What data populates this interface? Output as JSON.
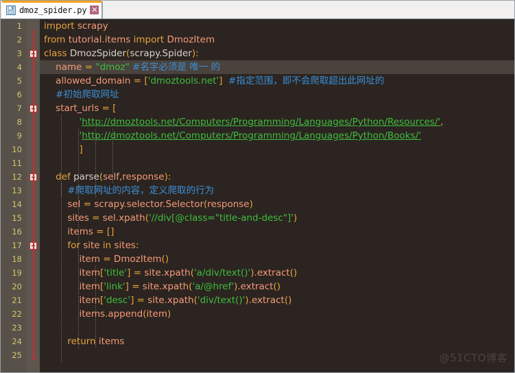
{
  "window": {
    "border_color": "#9aa0a6",
    "background": "#2b2420"
  },
  "tabbar": {
    "background": "#f1f0ef",
    "active_accent_color": "#f5a21e",
    "tabs": [
      {
        "label": "dmoz_spider.py",
        "icon": "save-floppy-icon",
        "close_label": "✕",
        "active": true
      }
    ]
  },
  "editor": {
    "theme": {
      "background": "#2b2420",
      "gutter_background": "#57514a",
      "line_number_color": "#cfc76a",
      "current_line_background": "#4a423c",
      "fold_line_color": "#d02a2a",
      "keyword_color": "#e8a33d",
      "string_color": "#3fbf3f",
      "comment_color": "#3b8fd6",
      "identifier_color": "#f79b7a",
      "text_color": "#d8d2cc"
    },
    "current_line": 4,
    "first_line_number": 1,
    "line_numbers": [
      1,
      2,
      3,
      4,
      5,
      6,
      7,
      8,
      9,
      10,
      11,
      12,
      13,
      14,
      15,
      16,
      17,
      18,
      19,
      20,
      21,
      22,
      23,
      24,
      25
    ],
    "fold_markers": [
      3,
      7,
      12,
      17
    ],
    "lines": [
      {
        "n": 1,
        "text": "import scrapy"
      },
      {
        "n": 2,
        "text": "from tutorial.items import DmozItem"
      },
      {
        "n": 3,
        "text": "class DmozSpider(scrapy.Spider):"
      },
      {
        "n": 4,
        "text": "    name = \"dmoz\" #名字必须是 唯一 的"
      },
      {
        "n": 5,
        "text": "    allowed_domain = ['dmoztools.net']  #指定范围，即不会爬取超出此网址的"
      },
      {
        "n": 6,
        "text": "    #初始爬取网址"
      },
      {
        "n": 7,
        "text": "    start_urls = ["
      },
      {
        "n": 8,
        "text": "            'http://dmoztools.net/Computers/Programming/Languages/Python/Resources/',"
      },
      {
        "n": 9,
        "text": "            'http://dmoztools.net/Computers/Programming/Languages/Python/Books/'"
      },
      {
        "n": 10,
        "text": "            ]"
      },
      {
        "n": 11,
        "text": ""
      },
      {
        "n": 12,
        "text": "    def parse(self,response):"
      },
      {
        "n": 13,
        "text": "        #爬取网址的内容，定义爬取的行为"
      },
      {
        "n": 14,
        "text": "        sel = scrapy.selector.Selector(response)"
      },
      {
        "n": 15,
        "text": "        sites = sel.xpath('//div[@class=\"title-and-desc\"]')"
      },
      {
        "n": 16,
        "text": "        items = []"
      },
      {
        "n": 17,
        "text": "        for site in sites:"
      },
      {
        "n": 18,
        "text": "            item = DmozItem()"
      },
      {
        "n": 19,
        "text": "            item['title'] = site.xpath('a/div/text()').extract()"
      },
      {
        "n": 20,
        "text": "            item['link'] = site.xpath('a/@href').extract()"
      },
      {
        "n": 21,
        "text": "            item['desc'] = site.xpath('div/text()').extract()"
      },
      {
        "n": 22,
        "text": "            items.append(item)"
      },
      {
        "n": 23,
        "text": ""
      },
      {
        "n": 24,
        "text": "        return items"
      },
      {
        "n": 25,
        "text": ""
      }
    ],
    "tokens": {
      "l1": [
        [
          "kw",
          "import"
        ],
        [
          "plain",
          " "
        ],
        [
          "nm",
          "scrapy"
        ]
      ],
      "l2": [
        [
          "kw",
          "from"
        ],
        [
          "plain",
          " "
        ],
        [
          "nm",
          "tutorial"
        ],
        [
          "op",
          "."
        ],
        [
          "nm",
          "items"
        ],
        [
          "plain",
          " "
        ],
        [
          "kw",
          "import"
        ],
        [
          "plain",
          " "
        ],
        [
          "nm",
          "DmozItem"
        ]
      ],
      "l3": [
        [
          "kw",
          "class"
        ],
        [
          "plain",
          " "
        ],
        [
          "cls",
          "DmozSpider"
        ],
        [
          "op",
          "("
        ],
        [
          "cls",
          "scrapy.Spider"
        ],
        [
          "op",
          "):"
        ]
      ],
      "l4": [
        [
          "nm",
          "name"
        ],
        [
          "plain",
          " "
        ],
        [
          "op",
          "="
        ],
        [
          "plain",
          " "
        ],
        [
          "str",
          "\"dmoz\""
        ],
        [
          "plain",
          " "
        ],
        [
          "cmt",
          "#名字必须是 唯一 的"
        ]
      ],
      "l5": [
        [
          "nm",
          "allowed_domain"
        ],
        [
          "plain",
          " "
        ],
        [
          "op",
          "="
        ],
        [
          "plain",
          " "
        ],
        [
          "op",
          "["
        ],
        [
          "str",
          "'dmoztools.net'"
        ],
        [
          "op",
          "]"
        ],
        [
          "plain",
          "  "
        ],
        [
          "cmt",
          "#指定范围，即不会爬取超出此网址的"
        ]
      ],
      "l6": [
        [
          "cmt",
          "#初始爬取网址"
        ]
      ],
      "l7": [
        [
          "nm",
          "start_urls"
        ],
        [
          "plain",
          " "
        ],
        [
          "op",
          "="
        ],
        [
          "plain",
          " "
        ],
        [
          "op",
          "["
        ]
      ],
      "l8": [
        [
          "str",
          "'"
        ],
        [
          "link",
          "http://dmoztools.net/Computers/Programming/Languages/Python/Resources/'"
        ],
        [
          "op",
          ","
        ]
      ],
      "l9": [
        [
          "str",
          "'"
        ],
        [
          "link",
          "http://dmoztools.net/Computers/Programming/Languages/Python/Books/'"
        ]
      ],
      "l10": [
        [
          "op",
          "]"
        ]
      ],
      "l12": [
        [
          "kw",
          "def"
        ],
        [
          "plain",
          " "
        ],
        [
          "fn",
          "parse"
        ],
        [
          "op",
          "("
        ],
        [
          "nm",
          "self,response"
        ],
        [
          "op",
          "):"
        ]
      ],
      "l13": [
        [
          "cmt",
          "#爬取网址的内容，定义爬取的行为"
        ]
      ],
      "l14": [
        [
          "nm",
          "sel"
        ],
        [
          "plain",
          " "
        ],
        [
          "op",
          "="
        ],
        [
          "plain",
          " "
        ],
        [
          "nm",
          "scrapy"
        ],
        [
          "op",
          "."
        ],
        [
          "nm",
          "selector"
        ],
        [
          "op",
          "."
        ],
        [
          "nm",
          "Selector"
        ],
        [
          "op",
          "("
        ],
        [
          "nm",
          "response"
        ],
        [
          "op",
          ")"
        ]
      ],
      "l15": [
        [
          "nm",
          "sites"
        ],
        [
          "plain",
          " "
        ],
        [
          "op",
          "="
        ],
        [
          "plain",
          " "
        ],
        [
          "nm",
          "sel"
        ],
        [
          "op",
          "."
        ],
        [
          "nm",
          "xpath"
        ],
        [
          "op",
          "("
        ],
        [
          "str",
          "'//div[@class=\"title-and-desc\"]'"
        ],
        [
          "op",
          ")"
        ]
      ],
      "l16": [
        [
          "nm",
          "items"
        ],
        [
          "plain",
          " "
        ],
        [
          "op",
          "="
        ],
        [
          "plain",
          " "
        ],
        [
          "op",
          "[]"
        ]
      ],
      "l17": [
        [
          "kw",
          "for"
        ],
        [
          "plain",
          " "
        ],
        [
          "nm",
          "site"
        ],
        [
          "plain",
          " "
        ],
        [
          "kw",
          "in"
        ],
        [
          "plain",
          " "
        ],
        [
          "nm",
          "sites"
        ],
        [
          "op",
          ":"
        ]
      ],
      "l18": [
        [
          "nm",
          "item"
        ],
        [
          "plain",
          " "
        ],
        [
          "op",
          "="
        ],
        [
          "plain",
          " "
        ],
        [
          "nm",
          "DmozItem"
        ],
        [
          "op",
          "()"
        ]
      ],
      "l19": [
        [
          "nm",
          "item"
        ],
        [
          "op",
          "["
        ],
        [
          "str",
          "'title'"
        ],
        [
          "op",
          "]"
        ],
        [
          "plain",
          " "
        ],
        [
          "op",
          "="
        ],
        [
          "plain",
          " "
        ],
        [
          "nm",
          "site"
        ],
        [
          "op",
          "."
        ],
        [
          "nm",
          "xpath"
        ],
        [
          "op",
          "("
        ],
        [
          "str",
          "'a/div/text()'"
        ],
        [
          "op",
          ")."
        ],
        [
          "nm",
          "extract"
        ],
        [
          "op",
          "()"
        ]
      ],
      "l20": [
        [
          "nm",
          "item"
        ],
        [
          "op",
          "["
        ],
        [
          "str",
          "'link'"
        ],
        [
          "op",
          "]"
        ],
        [
          "plain",
          " "
        ],
        [
          "op",
          "="
        ],
        [
          "plain",
          " "
        ],
        [
          "nm",
          "site"
        ],
        [
          "op",
          "."
        ],
        [
          "nm",
          "xpath"
        ],
        [
          "op",
          "("
        ],
        [
          "str",
          "'a/@href'"
        ],
        [
          "op",
          ")."
        ],
        [
          "nm",
          "extract"
        ],
        [
          "op",
          "()"
        ]
      ],
      "l21": [
        [
          "nm",
          "item"
        ],
        [
          "op",
          "["
        ],
        [
          "str",
          "'desc'"
        ],
        [
          "op",
          "]"
        ],
        [
          "plain",
          " "
        ],
        [
          "op",
          "="
        ],
        [
          "plain",
          " "
        ],
        [
          "nm",
          "site"
        ],
        [
          "op",
          "."
        ],
        [
          "nm",
          "xpath"
        ],
        [
          "op",
          "("
        ],
        [
          "str",
          "'div/text()'"
        ],
        [
          "op",
          ")."
        ],
        [
          "nm",
          "extract"
        ],
        [
          "op",
          "()"
        ]
      ],
      "l22": [
        [
          "nm",
          "items"
        ],
        [
          "op",
          "."
        ],
        [
          "nm",
          "append"
        ],
        [
          "op",
          "("
        ],
        [
          "nm",
          "item"
        ],
        [
          "op",
          ")"
        ]
      ],
      "l24": [
        [
          "kw",
          "return"
        ],
        [
          "plain",
          " "
        ],
        [
          "nm",
          "items"
        ]
      ]
    }
  },
  "watermark": {
    "text": "@51CTO博客"
  }
}
